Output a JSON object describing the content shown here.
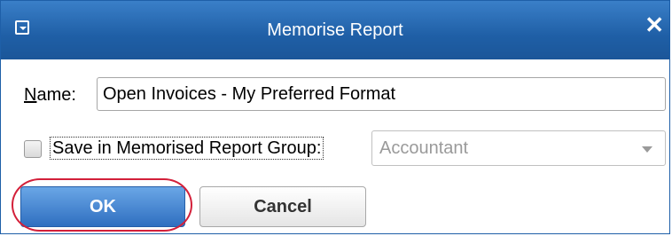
{
  "window": {
    "title": "Memorise Report",
    "close_glyph": "✕"
  },
  "form": {
    "name_label_accel": "N",
    "name_label_rest": "ame:",
    "name_value": "Open Invoices - My Preferred Format",
    "save_in_group_label": "Save in Memorised Report Group:",
    "save_in_group_checked": false,
    "group_value": "Accountant"
  },
  "buttons": {
    "ok_label": "OK",
    "cancel_label": "Cancel"
  },
  "colors": {
    "titlebar": "#1f5fa6",
    "highlight": "#d3203a"
  }
}
